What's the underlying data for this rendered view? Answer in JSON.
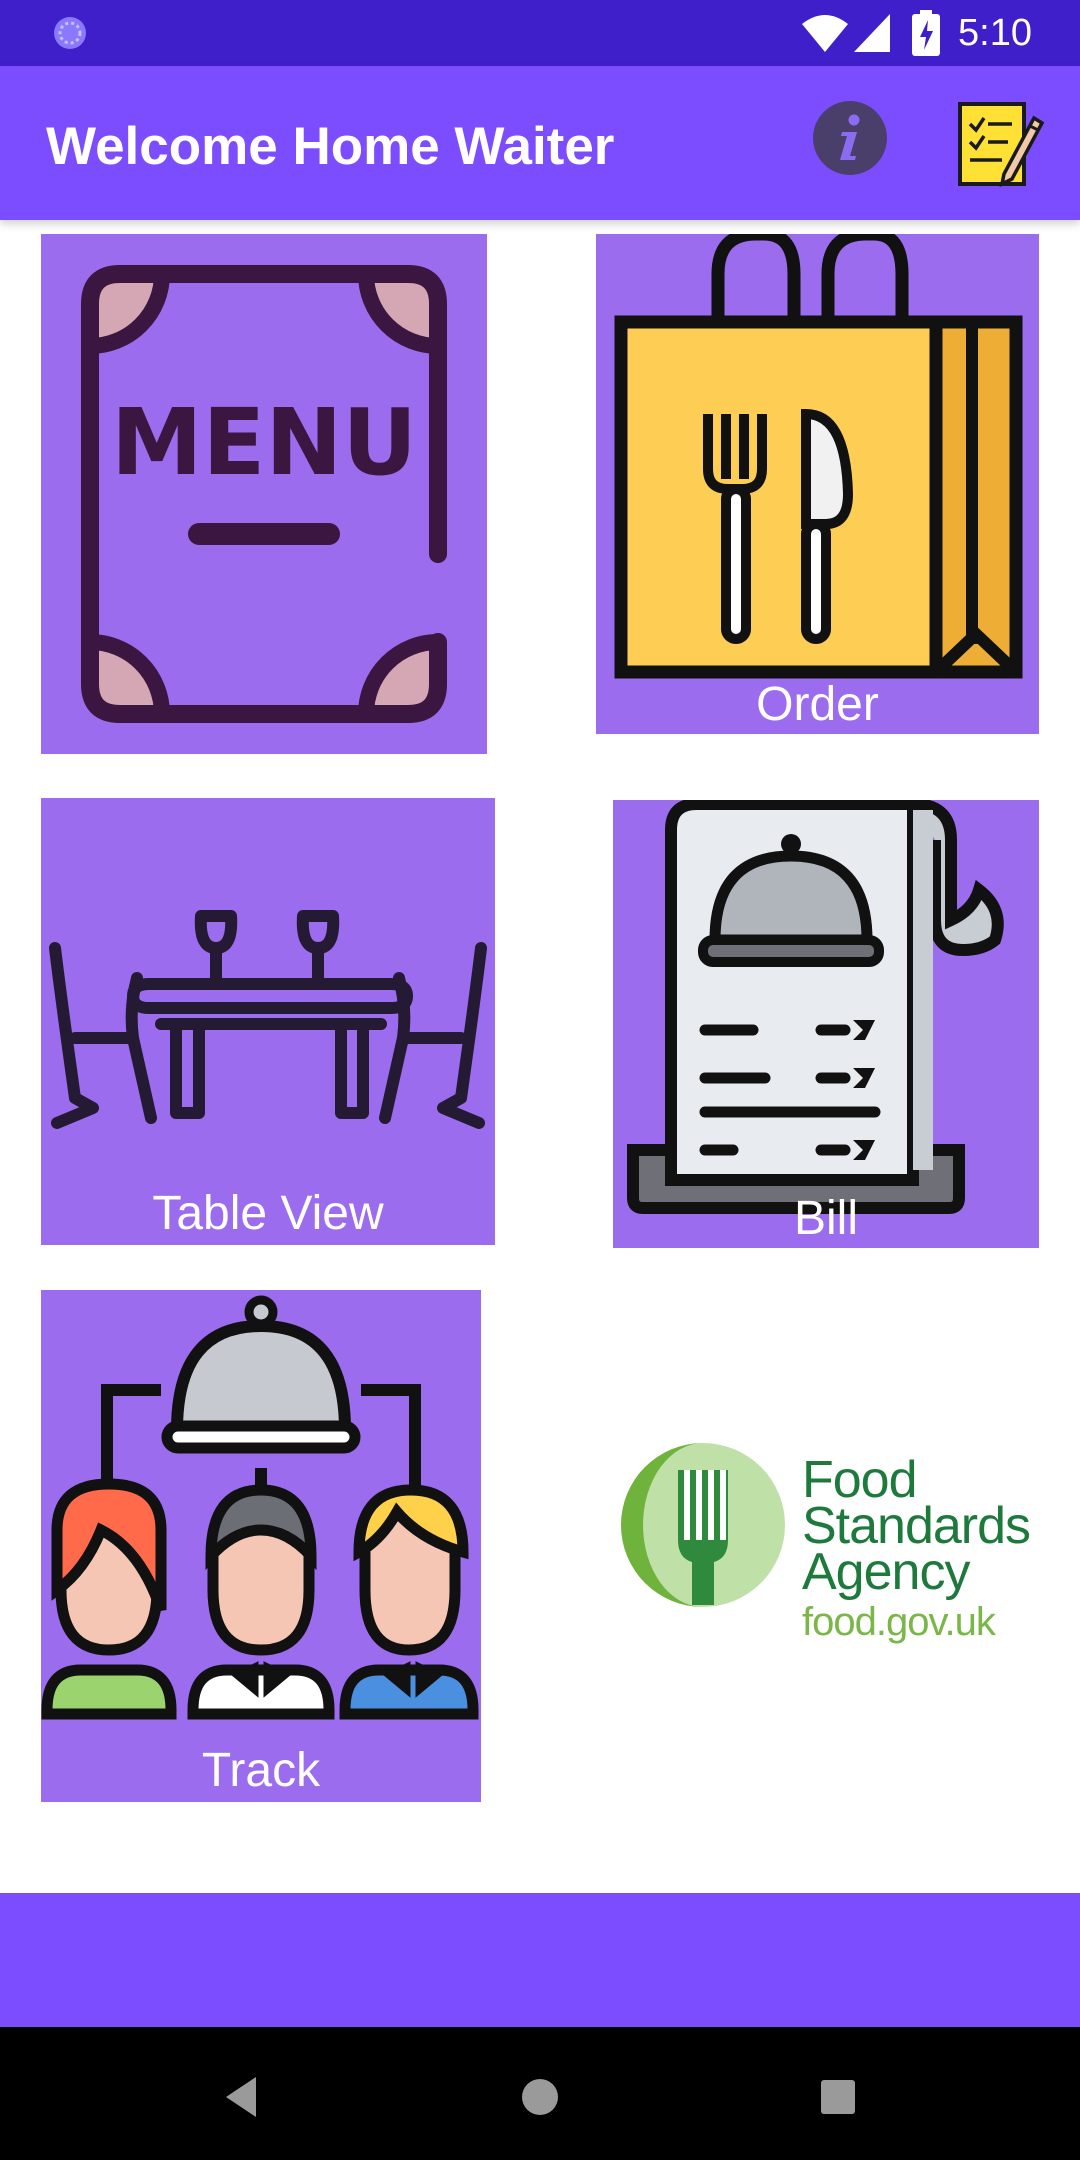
{
  "status_bar": {
    "time": "5:10",
    "icons": [
      "app-indicator-icon",
      "wifi-icon",
      "signal-icon",
      "battery-charging-icon"
    ]
  },
  "app_bar": {
    "title": "Welcome Home Waiter",
    "actions": [
      "info-icon",
      "notes-icon"
    ]
  },
  "tiles": [
    {
      "name": "menu",
      "label": "",
      "image_text": "MENU",
      "icon": "menu-card-icon"
    },
    {
      "name": "order",
      "label": "Order",
      "icon": "shopping-bag-cutlery-icon"
    },
    {
      "name": "table-view",
      "label": "Table View",
      "icon": "dining-table-icon"
    },
    {
      "name": "bill",
      "label": "Bill",
      "icon": "receipt-icon"
    },
    {
      "name": "track",
      "label": "Track",
      "icon": "waiters-cloche-icon"
    }
  ],
  "logo": {
    "line1": "Food",
    "line2": "Standards",
    "line3": "Agency",
    "url": "food.gov.uk"
  },
  "nav": {
    "buttons": [
      "back-icon",
      "home-icon",
      "recents-icon"
    ]
  },
  "colors": {
    "status_bar": "#3f1fc9",
    "app_bar": "#7c4dff",
    "tile": "#9b6ced",
    "logo_green": "#1e7a3c"
  }
}
